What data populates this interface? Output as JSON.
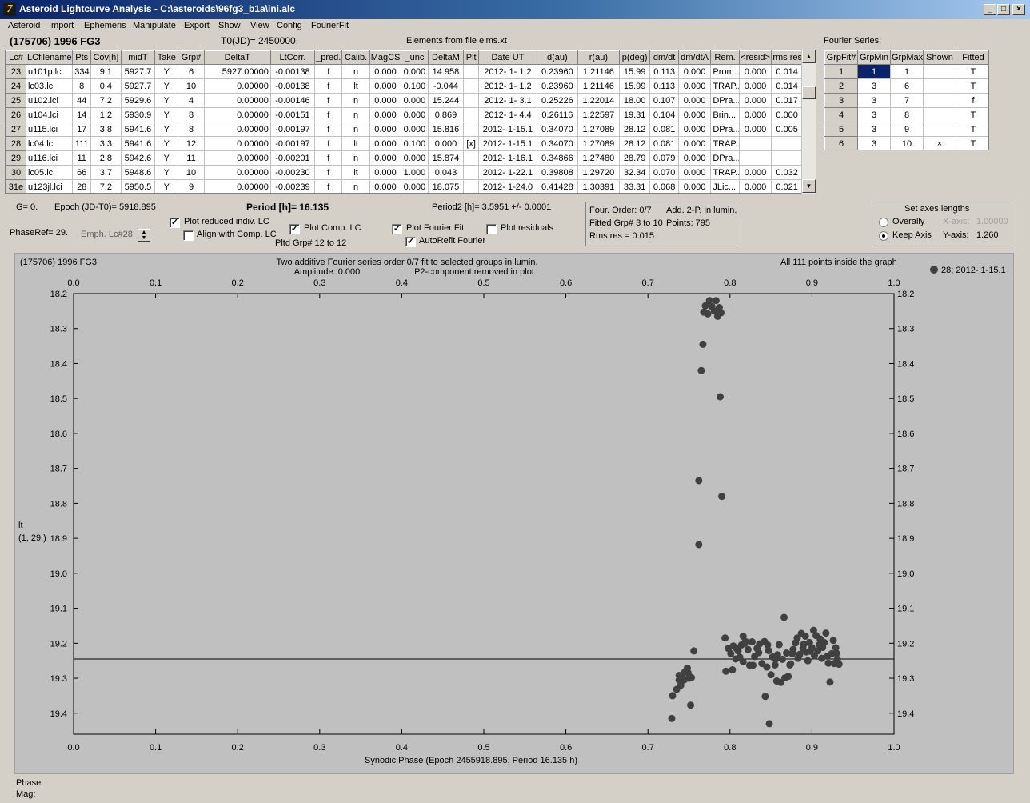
{
  "window": {
    "title": "Asteroid Lightcurve Analysis - C:\\asteroids\\96fg3_b1a\\ini.alc",
    "app_icon": "7",
    "controls": [
      "_",
      "□",
      "×"
    ]
  },
  "menu": [
    "Asteroid",
    "Import",
    "Ephemeris",
    "Manipulate",
    "Export",
    "Show",
    "View",
    "Config",
    "FourierFit"
  ],
  "header": {
    "asteroid": "(175706) 1996 FG3",
    "t0": "T0(JD)= 2450000.",
    "elements": "Elements from file elms.xt",
    "fourier_title": "Fourier Series:"
  },
  "lc_table": {
    "columns": [
      "Lc#",
      "LCfilename",
      "Pts",
      "Cov[h]",
      "midT",
      "Take",
      "Grp#",
      "DeltaT",
      "LtCorr.",
      "_pred.",
      "Calib.",
      "MagCS",
      "_unc",
      "DeltaM",
      "Plt",
      "Date UT",
      "d(au)",
      "r(au)",
      "p(deg)",
      "dm/dt",
      "dm/dtA",
      "Rem.",
      "<resid>",
      "rms res"
    ],
    "rows": [
      [
        "23",
        "u101p.lc",
        "334",
        "9.1",
        "5927.7",
        "Y",
        "6",
        "5927.00000",
        "-0.00138",
        "f",
        "n",
        "0.000",
        "0.000",
        "14.958",
        "",
        "2012- 1- 1.2",
        "0.23960",
        "1.21146",
        "15.99",
        "0.113",
        "0.000",
        "Prom...",
        "0.000",
        "0.014"
      ],
      [
        "24",
        "lc03.lc",
        "8",
        "0.4",
        "5927.7",
        "Y",
        "10",
        "0.00000",
        "-0.00138",
        "f",
        "lt",
        "0.000",
        "0.100",
        "-0.044",
        "",
        "2012- 1- 1.2",
        "0.23960",
        "1.21146",
        "15.99",
        "0.113",
        "0.000",
        "TRAP...",
        "0.000",
        "0.014"
      ],
      [
        "25",
        "u102.lci",
        "44",
        "7.2",
        "5929.6",
        "Y",
        "4",
        "0.00000",
        "-0.00146",
        "f",
        "n",
        "0.000",
        "0.000",
        "15.244",
        "",
        "2012- 1- 3.1",
        "0.25226",
        "1.22014",
        "18.00",
        "0.107",
        "0.000",
        "DPra...",
        "0.000",
        "0.017"
      ],
      [
        "26",
        "u104.lci",
        "14",
        "1.2",
        "5930.9",
        "Y",
        "8",
        "0.00000",
        "-0.00151",
        "f",
        "n",
        "0.000",
        "0.000",
        "0.869",
        "",
        "2012- 1- 4.4",
        "0.26116",
        "1.22597",
        "19.31",
        "0.104",
        "0.000",
        "Brin...",
        "0.000",
        "0.000"
      ],
      [
        "27",
        "u115.lci",
        "17",
        "3.8",
        "5941.6",
        "Y",
        "8",
        "0.00000",
        "-0.00197",
        "f",
        "n",
        "0.000",
        "0.000",
        "15.816",
        "",
        "2012- 1-15.1",
        "0.34070",
        "1.27089",
        "28.12",
        "0.081",
        "0.000",
        "DPra...",
        "0.000",
        "0.005"
      ],
      [
        "28",
        "lc04.lc",
        "111",
        "3.3",
        "5941.6",
        "Y",
        "12",
        "0.00000",
        "-0.00197",
        "f",
        "lt",
        "0.000",
        "0.100",
        "0.000",
        "[x]",
        "2012- 1-15.1",
        "0.34070",
        "1.27089",
        "28.12",
        "0.081",
        "0.000",
        "TRAP...",
        "",
        ""
      ],
      [
        "29",
        "u116.lci",
        "11",
        "2.8",
        "5942.6",
        "Y",
        "11",
        "0.00000",
        "-0.00201",
        "f",
        "n",
        "0.000",
        "0.000",
        "15.874",
        "",
        "2012- 1-16.1",
        "0.34866",
        "1.27480",
        "28.79",
        "0.079",
        "0.000",
        "DPra...",
        "",
        ""
      ],
      [
        "30",
        "lc05.lc",
        "66",
        "3.7",
        "5948.6",
        "Y",
        "10",
        "0.00000",
        "-0.00230",
        "f",
        "lt",
        "0.000",
        "1.000",
        "0.043",
        "",
        "2012- 1-22.1",
        "0.39808",
        "1.29720",
        "32.34",
        "0.070",
        "0.000",
        "TRAP...",
        "0.000",
        "0.032"
      ],
      [
        "31e",
        "u123jl.lci",
        "28",
        "7.2",
        "5950.5",
        "Y",
        "9",
        "0.00000",
        "-0.00239",
        "f",
        "n",
        "0.000",
        "0.000",
        "18.075",
        "",
        "2012- 1-24.0",
        "0.41428",
        "1.30391",
        "33.31",
        "0.068",
        "0.000",
        "JLic...",
        "0.000",
        "0.021"
      ]
    ]
  },
  "fourier_table": {
    "columns": [
      "GrpFit#",
      "GrpMin",
      "GrpMax",
      "Shown",
      "Fitted"
    ],
    "rows": [
      [
        "1",
        "1",
        "1",
        "",
        "T"
      ],
      [
        "2",
        "3",
        "6",
        "",
        "T"
      ],
      [
        "3",
        "3",
        "7",
        "",
        "f"
      ],
      [
        "4",
        "3",
        "8",
        "",
        "T"
      ],
      [
        "5",
        "3",
        "9",
        "",
        "T"
      ],
      [
        "6",
        "3",
        "10",
        "×",
        "T"
      ]
    ]
  },
  "controls": {
    "g": "G= 0.",
    "epoch": "Epoch (JD-T0)= 5918.895",
    "period": "Period [h]= 16.135",
    "period2": "Period2 [h]= 3.5951 +/- 0.0001",
    "phase_ref": "PhaseRef= 29.",
    "emph": "Emph. Lc#28:",
    "plot_reduced": "Plot reduced indiv. LC",
    "align_comp": "Align with Comp. LC",
    "plot_comp": "Plot Comp. LC",
    "plotted_grp": "Pltd Grp#  12 to   12",
    "plot_fourier": "Plot Fourier Fit",
    "autorefit": "AutoRefit Fourier",
    "plot_residuals": "Plot residuals"
  },
  "stats": {
    "order": "Four. Order:  0/7",
    "add": "Add. 2-P, in lumin.",
    "fitted": "Fitted Grp# 3 to 10",
    "points": "Points: 795",
    "rms": "Rms res      = 0.015"
  },
  "axes_box": {
    "title": "Set axes lengths",
    "overall": "Overally",
    "keep": "Keep Axis",
    "x_label": "X-axis:",
    "x_value": "1.00000",
    "y_label": "Y-axis:",
    "y_value": "1.260"
  },
  "plot": {
    "top_left": "(175706) 1996 FG3",
    "title_line1": "Two additive Fourier series order 0/7 fit to selected groups in lumin.",
    "amplitude": "Amplitude: 0.000",
    "p2_removed": "P2-component removed in plot",
    "inside": "All 111 points inside the graph",
    "legend": "28; 2012- 1-15.1",
    "y_side_label1": "lt",
    "y_side_label2": "(1, 29.)",
    "x_axis_label": "Synodic Phase (Epoch 2455918.895, Period 16.135 h)",
    "fit_line_mag": 19.245
  },
  "footer": {
    "phase": "Phase:",
    "mag": "Mag:"
  },
  "chart_data": {
    "type": "scatter",
    "xlabel": "Synodic Phase (Epoch 2455918.895, Period 16.135 h)",
    "ylabel": "",
    "xlim": [
      0.0,
      1.0
    ],
    "ylim": [
      18.2,
      19.46
    ],
    "y_inverted": true,
    "x_ticks": [
      "0.0",
      "0.1",
      "0.2",
      "0.3",
      "0.4",
      "0.5",
      "0.6",
      "0.7",
      "0.8",
      "0.9",
      "1.0"
    ],
    "y_ticks": [
      "18.2",
      "18.3",
      "18.4",
      "18.5",
      "18.6",
      "18.7",
      "18.8",
      "18.9",
      "19.0",
      "19.1",
      "19.2",
      "19.3",
      "19.4"
    ],
    "grid": false,
    "legend": "top-right",
    "marker_color": "#404040",
    "series": [
      {
        "name": "28; 2012- 1-15.1",
        "points": [
          [
            0.775,
            18.22
          ],
          [
            0.783,
            18.22
          ],
          [
            0.77,
            18.235
          ],
          [
            0.778,
            18.237
          ],
          [
            0.787,
            18.24
          ],
          [
            0.768,
            18.253
          ],
          [
            0.773,
            18.258
          ],
          [
            0.781,
            18.25
          ],
          [
            0.789,
            18.255
          ],
          [
            0.785,
            18.265
          ],
          [
            0.767,
            18.345
          ],
          [
            0.765,
            18.42
          ],
          [
            0.788,
            18.495
          ],
          [
            0.762,
            18.735
          ],
          [
            0.79,
            18.78
          ],
          [
            0.762,
            18.918
          ],
          [
            0.756,
            19.222
          ],
          [
            0.73,
            19.35
          ],
          [
            0.735,
            19.332
          ],
          [
            0.738,
            19.305
          ],
          [
            0.742,
            19.298
          ],
          [
            0.745,
            19.282
          ],
          [
            0.748,
            19.271
          ],
          [
            0.75,
            19.3
          ],
          [
            0.753,
            19.298
          ],
          [
            0.74,
            19.32
          ],
          [
            0.752,
            19.377
          ],
          [
            0.729,
            19.415
          ],
          [
            0.738,
            19.292
          ],
          [
            0.749,
            19.285
          ],
          [
            0.794,
            19.185
          ],
          [
            0.798,
            19.215
          ],
          [
            0.801,
            19.23
          ],
          [
            0.804,
            19.208
          ],
          [
            0.807,
            19.245
          ],
          [
            0.81,
            19.222
          ],
          [
            0.812,
            19.24
          ],
          [
            0.814,
            19.205
          ],
          [
            0.816,
            19.18
          ],
          [
            0.819,
            19.195
          ],
          [
            0.822,
            19.218
          ],
          [
            0.824,
            19.263
          ],
          [
            0.827,
            19.196
          ],
          [
            0.83,
            19.238
          ],
          [
            0.833,
            19.215
          ],
          [
            0.836,
            19.202
          ],
          [
            0.839,
            19.258
          ],
          [
            0.842,
            19.195
          ],
          [
            0.845,
            19.268
          ],
          [
            0.847,
            19.221
          ],
          [
            0.85,
            19.29
          ],
          [
            0.852,
            19.239
          ],
          [
            0.855,
            19.262
          ],
          [
            0.858,
            19.233
          ],
          [
            0.86,
            19.204
          ],
          [
            0.862,
            19.312
          ],
          [
            0.864,
            19.246
          ],
          [
            0.866,
            19.126
          ],
          [
            0.869,
            19.228
          ],
          [
            0.871,
            19.295
          ],
          [
            0.874,
            19.259
          ],
          [
            0.877,
            19.218
          ],
          [
            0.88,
            19.199
          ],
          [
            0.882,
            19.185
          ],
          [
            0.885,
            19.232
          ],
          [
            0.887,
            19.172
          ],
          [
            0.89,
            19.203
          ],
          [
            0.892,
            19.18
          ],
          [
            0.895,
            19.25
          ],
          [
            0.897,
            19.198
          ],
          [
            0.9,
            19.213
          ],
          [
            0.902,
            19.163
          ],
          [
            0.905,
            19.178
          ],
          [
            0.907,
            19.222
          ],
          [
            0.91,
            19.188
          ],
          [
            0.912,
            19.243
          ],
          [
            0.915,
            19.198
          ],
          [
            0.917,
            19.171
          ],
          [
            0.92,
            19.257
          ],
          [
            0.922,
            19.311
          ],
          [
            0.924,
            19.23
          ],
          [
            0.927,
            19.258
          ],
          [
            0.929,
            19.213
          ],
          [
            0.931,
            19.246
          ],
          [
            0.933,
            19.26
          ],
          [
            0.795,
            19.28
          ],
          [
            0.803,
            19.276
          ],
          [
            0.816,
            19.253
          ],
          [
            0.828,
            19.263
          ],
          [
            0.843,
            19.352
          ],
          [
            0.848,
            19.43
          ],
          [
            0.857,
            19.308
          ],
          [
            0.867,
            19.299
          ],
          [
            0.873,
            19.262
          ],
          [
            0.883,
            19.243
          ],
          [
            0.893,
            19.225
          ],
          [
            0.903,
            19.236
          ],
          [
            0.913,
            19.212
          ],
          [
            0.926,
            19.192
          ],
          [
            0.919,
            19.237
          ],
          [
            0.808,
            19.215
          ],
          [
            0.818,
            19.2
          ],
          [
            0.835,
            19.227
          ],
          [
            0.846,
            19.205
          ],
          [
            0.856,
            19.245
          ],
          [
            0.876,
            19.23
          ],
          [
            0.889,
            19.215
          ],
          [
            0.898,
            19.223
          ],
          [
            0.909,
            19.204
          ],
          [
            0.93,
            19.229
          ],
          [
            0.744,
            19.305
          ]
        ]
      }
    ]
  }
}
